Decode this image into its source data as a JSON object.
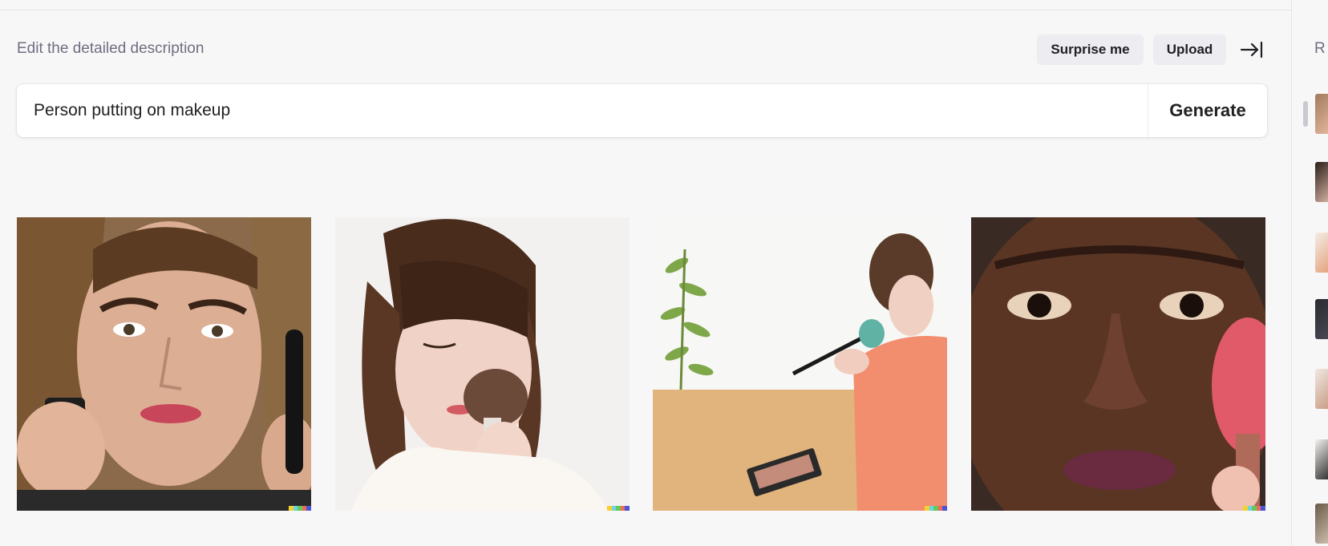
{
  "editor": {
    "description_label": "Edit the detailed description",
    "surprise_label": "Surprise me",
    "upload_label": "Upload",
    "collapse_icon": "arrow-right-to-bar-icon",
    "prompt_value": "Person putting on makeup",
    "generate_label": "Generate"
  },
  "results": [
    {
      "subject": "woman frowning applying lipstick"
    },
    {
      "subject": "woman with blush brush"
    },
    {
      "subject": "woman at table with brush and palette"
    },
    {
      "subject": "man close-up with pink brush"
    }
  ],
  "signature_colors": [
    "#f5d130",
    "#6fd3e0",
    "#62c95a",
    "#f06b5a",
    "#4a55d6"
  ],
  "sidebar": {
    "title": "R",
    "thumbnail_count": 7
  }
}
